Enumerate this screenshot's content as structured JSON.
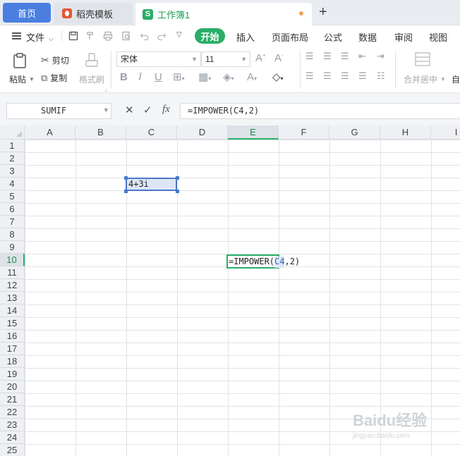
{
  "tabs": {
    "home": "首页",
    "template": "稻壳模板",
    "workbook": "工作簿1"
  },
  "menu": {
    "file": "文件",
    "items": [
      "开始",
      "插入",
      "页面布局",
      "公式",
      "数据",
      "审阅",
      "视图"
    ]
  },
  "ribbon": {
    "paste": "粘贴",
    "cut": "剪切",
    "copy": "复制",
    "format_painter": "格式刷",
    "font_name": "宋体",
    "font_size": "11",
    "merge_center": "合并居中",
    "auto": "自"
  },
  "formula_bar": {
    "name_box": "SUMIF",
    "formula": "=IMPOWER(C4,2)"
  },
  "sheet": {
    "columns": [
      "A",
      "B",
      "C",
      "D",
      "E",
      "F",
      "G",
      "H",
      "I"
    ],
    "active_column": "E",
    "rows": [
      "1",
      "2",
      "3",
      "4",
      "5",
      "6",
      "7",
      "8",
      "9",
      "10",
      "11",
      "12",
      "13",
      "14",
      "15",
      "16",
      "17",
      "18",
      "19",
      "20",
      "21",
      "22",
      "23",
      "24",
      "25"
    ],
    "active_row": "10",
    "cell_C4": "4+3i",
    "cell_E10": {
      "prefix": "=IMPOWER(",
      "ref": "C4",
      "suffix": ",2)"
    }
  },
  "watermark": {
    "text": "Baidu经验",
    "sub": "jingyan.baidu.com"
  },
  "colors": {
    "accent_green": "#2aae67",
    "home_tab_blue": "#4a7fe0",
    "selection_blue": "#4a78c9"
  }
}
